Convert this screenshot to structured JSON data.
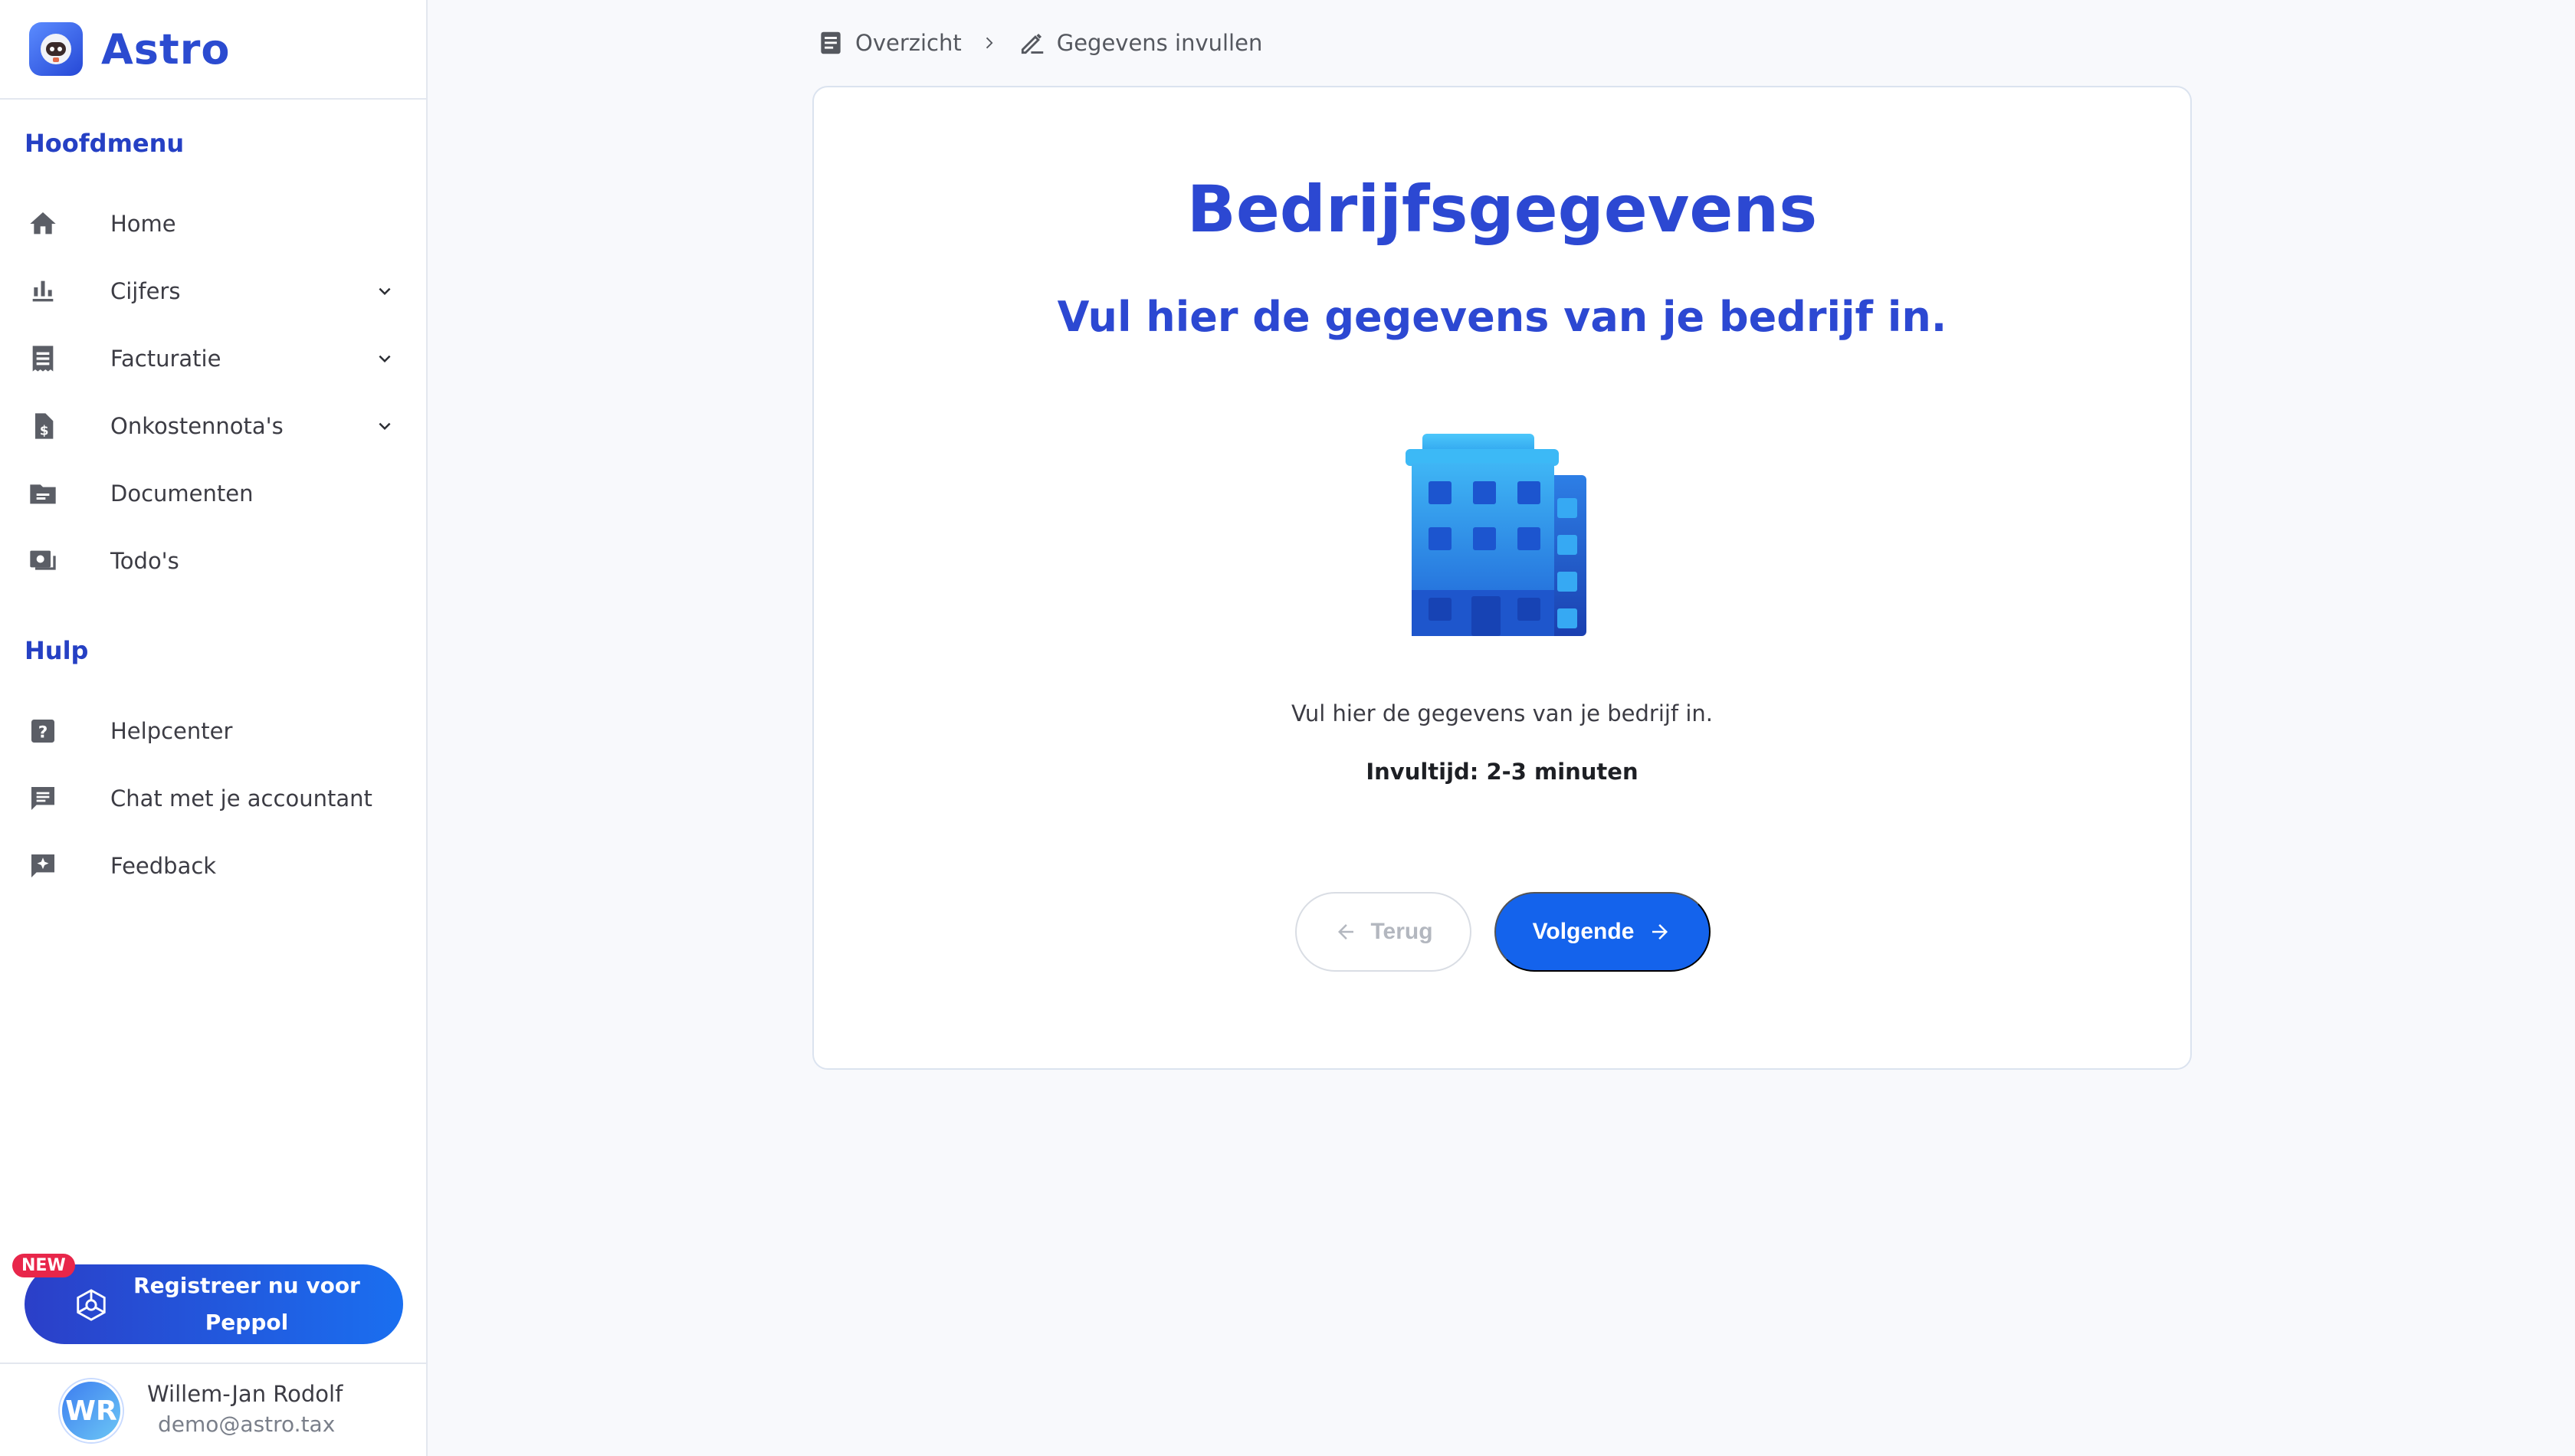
{
  "app": {
    "name": "Astro",
    "logo_icon": "astronaut-logo-icon"
  },
  "sidebar": {
    "main_section_title": "Hoofdmenu",
    "main_items": [
      {
        "label": "Home",
        "icon": "home-icon",
        "expandable": false
      },
      {
        "label": "Cijfers",
        "icon": "bar-chart-icon",
        "expandable": true
      },
      {
        "label": "Facturatie",
        "icon": "receipt-icon",
        "expandable": true
      },
      {
        "label": "Onkostennota's",
        "icon": "dollar-document-icon",
        "expandable": true
      },
      {
        "label": "Documenten",
        "icon": "folder-icon",
        "expandable": false
      },
      {
        "label": "Todo's",
        "icon": "todo-icon",
        "expandable": false
      }
    ],
    "help_section_title": "Hulp",
    "help_items": [
      {
        "label": "Helpcenter",
        "icon": "help-icon"
      },
      {
        "label": "Chat met je accountant",
        "icon": "chat-icon"
      },
      {
        "label": "Feedback",
        "icon": "feedback-icon"
      }
    ],
    "peppol": {
      "badge": "NEW",
      "label_line1": "Registreer nu voor",
      "label_line2": "Peppol"
    },
    "user": {
      "initials": "WR",
      "name": "Willem-Jan Rodolf",
      "email": "demo@astro.tax"
    }
  },
  "breadcrumb": {
    "items": [
      {
        "label": "Overzicht",
        "icon": "document-icon"
      },
      {
        "label": "Gegevens invullen",
        "icon": "edit-icon"
      }
    ]
  },
  "card": {
    "title": "Bedrijfsgegevens",
    "subtitle": "Vul hier de gegevens van je bedrijf in.",
    "illustration": "office-building-icon",
    "description": "Vul hier de gegevens van je bedrijf in.",
    "fill_time": "Invultijd: 2-3 minuten",
    "back_label": "Terug",
    "next_label": "Volgende"
  },
  "colors": {
    "accent": "#2c48d2",
    "primary_button": "#1463ec",
    "badge": "#e8264a",
    "background": "#f8f9fc"
  }
}
